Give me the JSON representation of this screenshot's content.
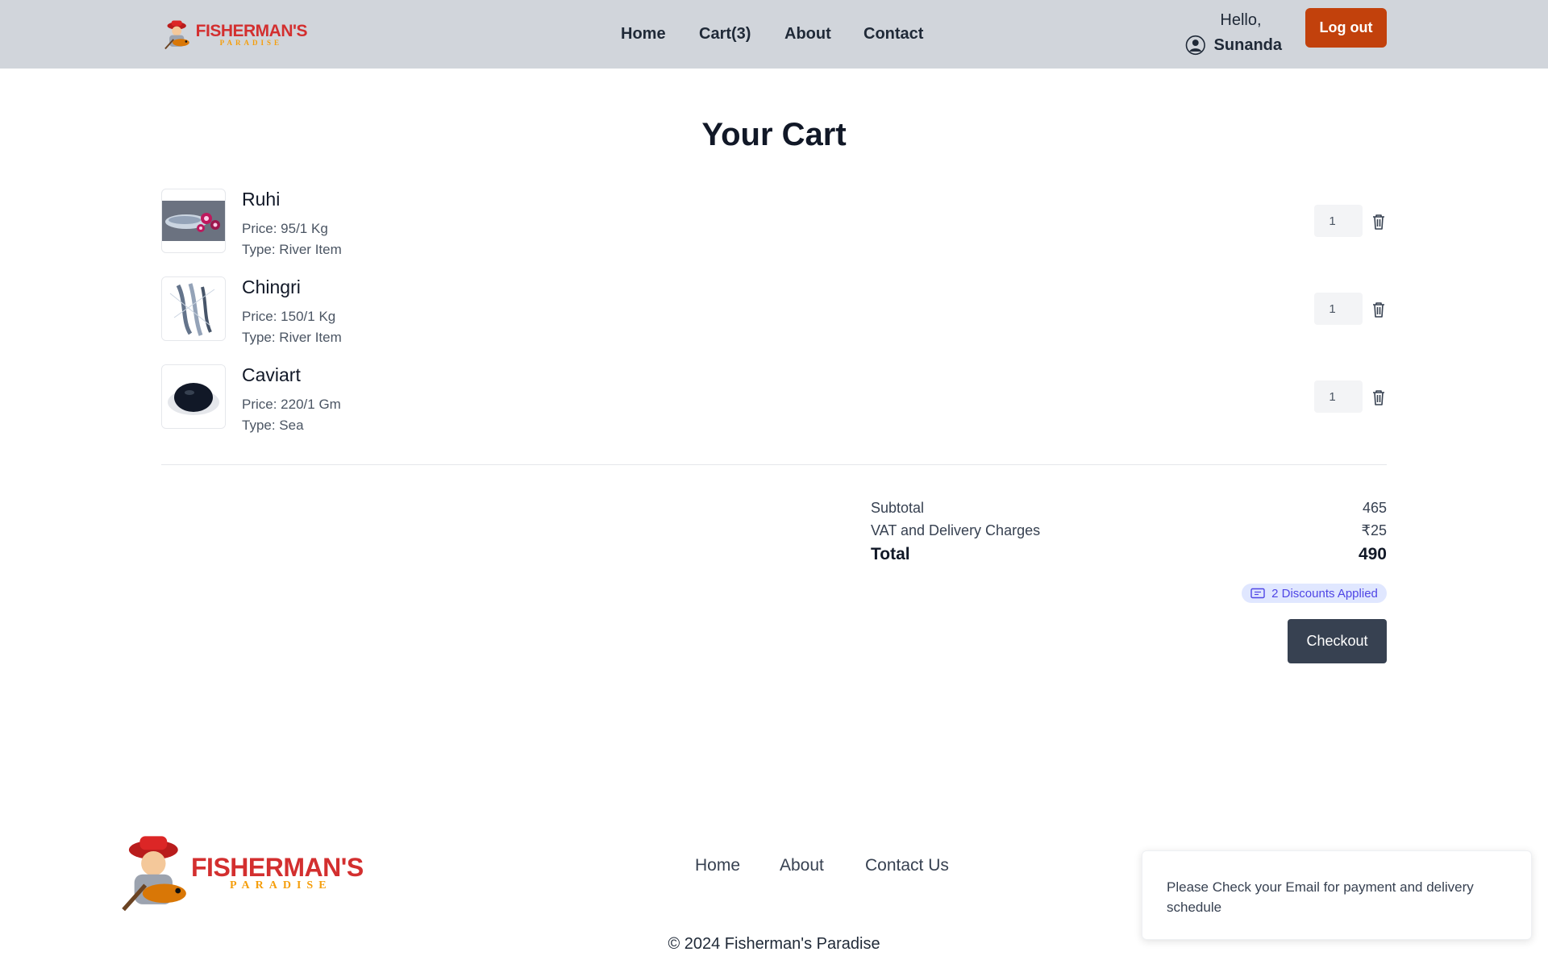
{
  "header": {
    "logo_title": "FISHERMAN'S",
    "logo_sub": "PARADISE",
    "nav": [
      "Home",
      "Cart(3)",
      "About",
      "Contact"
    ],
    "greeting": "Hello,",
    "username": "Sunanda",
    "logout_label": "Log out"
  },
  "main": {
    "title": "Your Cart",
    "items": [
      {
        "name": "Ruhi",
        "price": "Price: 95/1 Kg",
        "type": "Type: River Item",
        "quantity": "1",
        "image": "fish-image"
      },
      {
        "name": "Chingri",
        "price": "Price: 150/1 Kg",
        "type": "Type: River Item",
        "quantity": "1",
        "image": "prawn-image"
      },
      {
        "name": "Caviart",
        "price": "Price: 220/1 Gm",
        "type": "Type: Sea",
        "quantity": "1",
        "image": "caviar-image"
      }
    ],
    "summary": {
      "subtotal_label": "Subtotal",
      "subtotal_value": "465",
      "vat_label": "VAT and Delivery Charges",
      "vat_value": "₹25",
      "total_label": "Total",
      "total_value": "490"
    },
    "discount_badge": "2 Discounts Applied",
    "checkout_label": "Checkout"
  },
  "footer": {
    "logo_title": "FISHERMAN'S",
    "logo_sub": "PARADISE",
    "links": [
      "Home",
      "About",
      "Contact Us"
    ],
    "copyright": "© 2024 Fisherman's Paradise"
  },
  "toast": {
    "message": "Please Check your Email for payment and delivery schedule"
  },
  "colors": {
    "header_bg": "#d1d5db",
    "logout_bg": "#c2410c",
    "checkout_bg": "#374151",
    "badge_bg": "#e0e7ff",
    "badge_text": "#4f46e5",
    "logo_red": "#d32f2f",
    "logo_orange": "#f59e0b"
  }
}
